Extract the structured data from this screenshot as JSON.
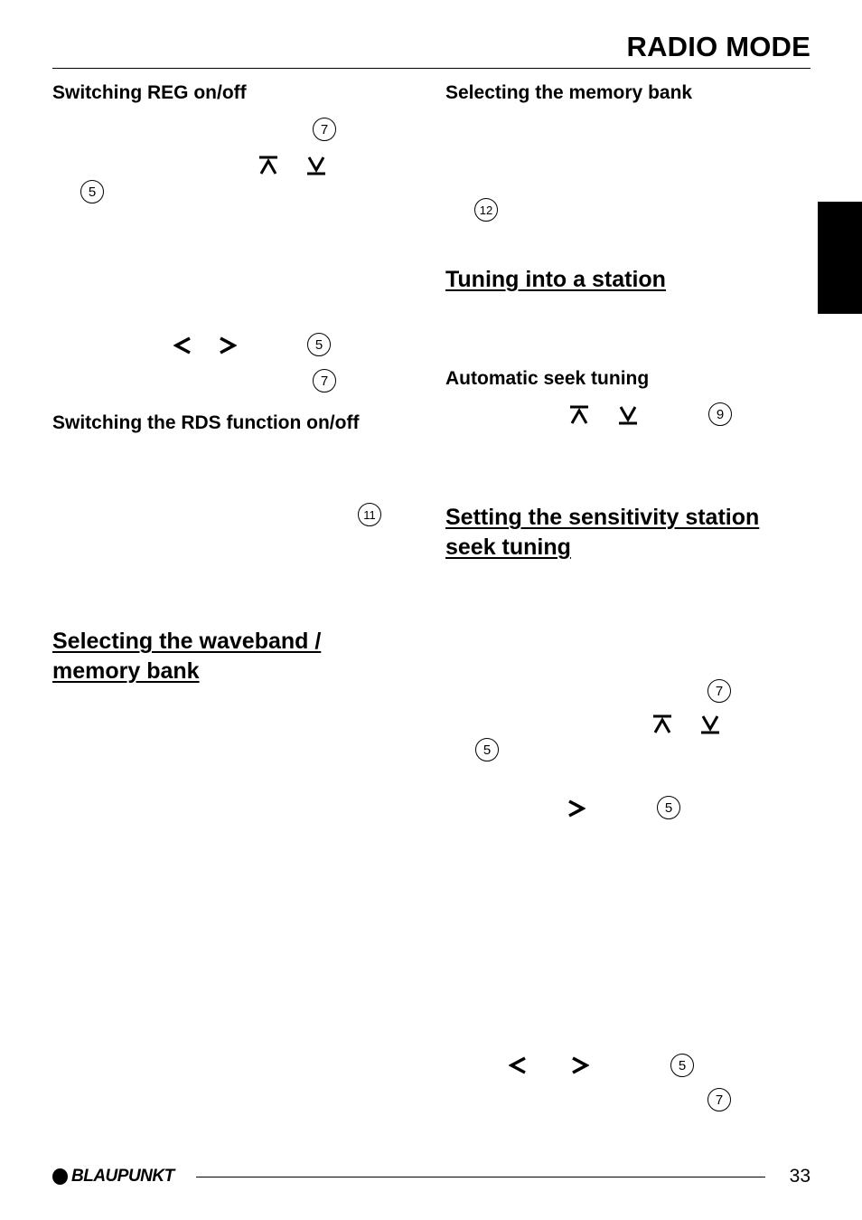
{
  "header": {
    "title": "RADIO MODE"
  },
  "left_column": {
    "reg_heading": "Switching REG on/off",
    "rds_heading": "Switching the RDS function on/off",
    "waveband_heading_line1": "Selecting the waveband /",
    "waveband_heading_line2": "memory bank"
  },
  "right_column": {
    "memory_bank_heading": "Selecting the memory bank",
    "tuning_heading": "Tuning into a station",
    "seek_heading": "Automatic seek tuning",
    "sensitivity_heading_line1": "Setting the sensitivity station",
    "sensitivity_heading_line2": "seek tuning"
  },
  "callouts": {
    "reg_7": "7",
    "reg_5": "5",
    "lr_5": "5",
    "lr_7": "7",
    "rds_11": "11",
    "mem_12": "12",
    "seek_9": "9",
    "sens_7": "7",
    "sens_5a": "5",
    "sens_5b": "5",
    "bottom_5": "5",
    "bottom_7": "7"
  },
  "icons": {
    "up": "seek-up-icon",
    "down": "seek-down-icon",
    "left": "chevron-left-icon",
    "right": "chevron-right-icon"
  },
  "footer": {
    "brand": "BLAUPUNKT",
    "page_number": "33"
  }
}
